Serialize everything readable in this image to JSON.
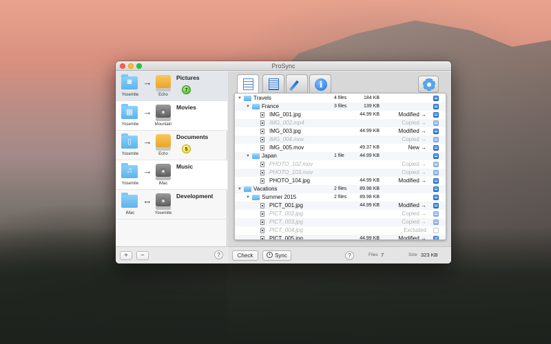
{
  "window": {
    "title": "ProSync"
  },
  "sidebar": {
    "items": [
      {
        "title": "Pictures",
        "source": "Yosemite",
        "destination": "Echo",
        "direction": "→",
        "source_icon": "camera-icon",
        "dest_type": "orange-disk",
        "badge": "7",
        "badge_color": "#35b51b"
      },
      {
        "title": "Movies",
        "source": "Yosemite",
        "destination": "Mountain",
        "direction": "→",
        "source_icon": "film-icon",
        "dest_type": "gray-disk",
        "badge": ""
      },
      {
        "title": "Documents",
        "source": "Yosemite",
        "destination": "Echo",
        "direction": "→",
        "source_icon": "document-icon",
        "dest_type": "orange-disk",
        "badge": "5",
        "badge_color": "#e9d314"
      },
      {
        "title": "Music",
        "source": "Yosemite",
        "destination": "iMac",
        "direction": "→",
        "source_icon": "music-note-icon",
        "dest_type": "gray-disk",
        "badge": ""
      },
      {
        "title": "Development",
        "source": "iMac",
        "destination": "Yosemite",
        "direction": "↔",
        "source_icon": "folder-icon",
        "dest_type": "gray-disk",
        "badge": ""
      }
    ],
    "add_label": "+",
    "remove_label": "−",
    "help_label": "?"
  },
  "tabs": [
    {
      "name": "file-list",
      "icon": "file-list-icon",
      "active": true
    },
    {
      "name": "text-log",
      "icon": "text-document-icon",
      "active": false
    },
    {
      "name": "edit",
      "icon": "pencil-icon",
      "active": false
    },
    {
      "name": "info",
      "icon": "info-icon",
      "active": false,
      "glyph": "i"
    }
  ],
  "settings_icon": "gear-icon",
  "file_tree": [
    {
      "level": 0,
      "type": "folder",
      "name": "Travels",
      "files": "4 files",
      "size": "184 KB",
      "status": "",
      "check": "checked",
      "dim": false
    },
    {
      "level": 1,
      "type": "folder",
      "name": "France",
      "files": "3 files",
      "size": "139 KB",
      "status": "",
      "check": "checked",
      "dim": false
    },
    {
      "level": 2,
      "type": "file",
      "name": "IMG_001.jpg",
      "files": "",
      "size": "44.99 KB",
      "status": "Modified →",
      "check": "checked",
      "dim": false
    },
    {
      "level": 2,
      "type": "file",
      "name": "IMG_002.mp4",
      "files": "",
      "size": "",
      "status": "Copied →",
      "check": "checked",
      "dim": true
    },
    {
      "level": 2,
      "type": "file",
      "name": "IMG_003.jpg",
      "files": "",
      "size": "44.99 KB",
      "status": "Modified →",
      "check": "checked",
      "dim": false
    },
    {
      "level": 2,
      "type": "file",
      "name": "IMG_004.mov",
      "files": "",
      "size": "",
      "status": "Copied →",
      "check": "checked",
      "dim": true
    },
    {
      "level": 2,
      "type": "file",
      "name": "IMG_005.mov",
      "files": "",
      "size": "49.37 KB",
      "status": "New →",
      "check": "checked",
      "dim": false
    },
    {
      "level": 1,
      "type": "folder",
      "name": "Japan",
      "files": "1 file",
      "size": "44.99 KB",
      "status": "",
      "check": "checked",
      "dim": false
    },
    {
      "level": 2,
      "type": "file",
      "name": "PHOTO_102.mov",
      "files": "",
      "size": "",
      "status": "Copied →",
      "check": "checked",
      "dim": true
    },
    {
      "level": 2,
      "type": "file",
      "name": "PHOTO_103.mov",
      "files": "",
      "size": "",
      "status": "Copied →",
      "check": "checked",
      "dim": true
    },
    {
      "level": 2,
      "type": "file",
      "name": "PHOTO_104.jpg",
      "files": "",
      "size": "44.99 KB",
      "status": "Modified →",
      "check": "checked",
      "dim": false
    },
    {
      "level": 0,
      "type": "folder",
      "name": "Vacations",
      "files": "2 files",
      "size": "89.98 KB",
      "status": "",
      "check": "checked",
      "dim": false
    },
    {
      "level": 1,
      "type": "folder",
      "name": "Summer 2015",
      "files": "2 files",
      "size": "89.98 KB",
      "status": "",
      "check": "checked",
      "dim": false
    },
    {
      "level": 2,
      "type": "file",
      "name": "PICT_001.jpg",
      "files": "",
      "size": "44.99 KB",
      "status": "Modified →",
      "check": "checked",
      "dim": false
    },
    {
      "level": 2,
      "type": "file",
      "name": "PICT_002.jpg",
      "files": "",
      "size": "",
      "status": "Copied →",
      "check": "checked",
      "dim": true
    },
    {
      "level": 2,
      "type": "file",
      "name": "PICT_003.jpg",
      "files": "",
      "size": "",
      "status": "Copied →",
      "check": "checked",
      "dim": true
    },
    {
      "level": 2,
      "type": "file",
      "name": "PICT_004.jpg",
      "files": "",
      "size": "",
      "status": "Excluded",
      "check": "unchecked",
      "dim": true
    },
    {
      "level": 2,
      "type": "file",
      "name": "PICT_005.jpg",
      "files": "",
      "size": "44.99 KB",
      "status": "Modified →",
      "check": "ticked",
      "dim": false
    }
  ],
  "bottom": {
    "check_label": "Check",
    "sync_label": "Sync",
    "help_label": "?",
    "files_label": "Files",
    "files_value": "7",
    "size_label": "Size",
    "size_value": "323 KB"
  }
}
